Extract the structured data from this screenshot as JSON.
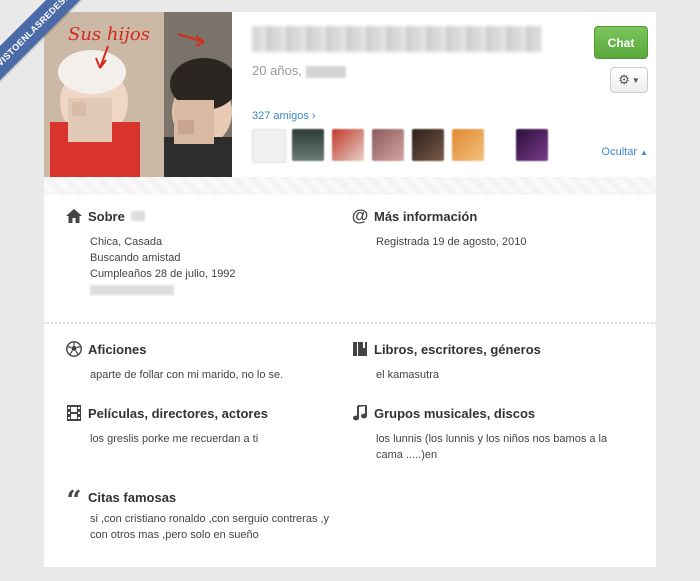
{
  "watermark": {
    "text": "VISTOENLASREDES.com"
  },
  "cover": {
    "annotation": "Sus hijos"
  },
  "profile": {
    "age_text": "20 años,",
    "friends_label": "327 amigos ›",
    "hide_label": "Ocultar",
    "chat_label": "Chat",
    "gear_icon": "gear-icon"
  },
  "about": {
    "title": "Sobre",
    "lines": [
      "Chica, Casada",
      "Buscando amistad",
      "Cumpleaños 28 de julio, 1992"
    ]
  },
  "more_info": {
    "title": "Más información",
    "lines": [
      "Registrada 19 de agosto, 2010"
    ]
  },
  "hobbies": {
    "title": "Aficiones",
    "body": "aparte de follar con mi marido, no lo se."
  },
  "books": {
    "title": "Libros, escritores, géneros",
    "body": "el kamasutra"
  },
  "movies": {
    "title": "Películas, directores, actores",
    "body": "los greslis porke me recuerdan a ti"
  },
  "music": {
    "title": "Grupos musicales, discos",
    "body_line1": "los lunnis (los lunnis y los niños nos bamos a la",
    "body_line2": "cama .....)en"
  },
  "quotes": {
    "title": "Citas famosas",
    "body_line1": "si ,con cristiano ronaldo ,con serguio contreras ,y",
    "body_line2": "con otros mas ,pero solo en sueño"
  },
  "colors": {
    "chat_green": "#62b043",
    "link_blue": "#3b87c8",
    "watermark_blue": "#4b6aa8",
    "annotation_red": "#d42a1e"
  }
}
